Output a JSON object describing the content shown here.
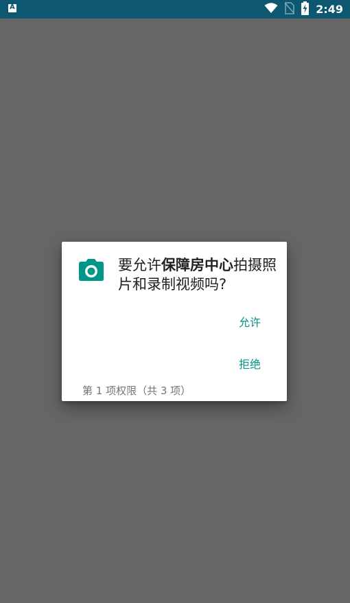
{
  "status_bar": {
    "time": "2:49",
    "icons": [
      "app-notification-icon",
      "wifi-icon",
      "no-sim-icon",
      "battery-charging-icon"
    ]
  },
  "dialog": {
    "icon": "camera-icon",
    "title_prefix": "要允许",
    "app_name": "保障房中心",
    "title_suffix": "拍摄照片和录制视频吗?",
    "allow_label": "允许",
    "deny_label": "拒绝",
    "counter": "第 1 项权限（共 3 项）"
  },
  "colors": {
    "status_bar": "#0d5770",
    "scrim": "#666666",
    "accent": "#009688",
    "camera": "#009688"
  }
}
